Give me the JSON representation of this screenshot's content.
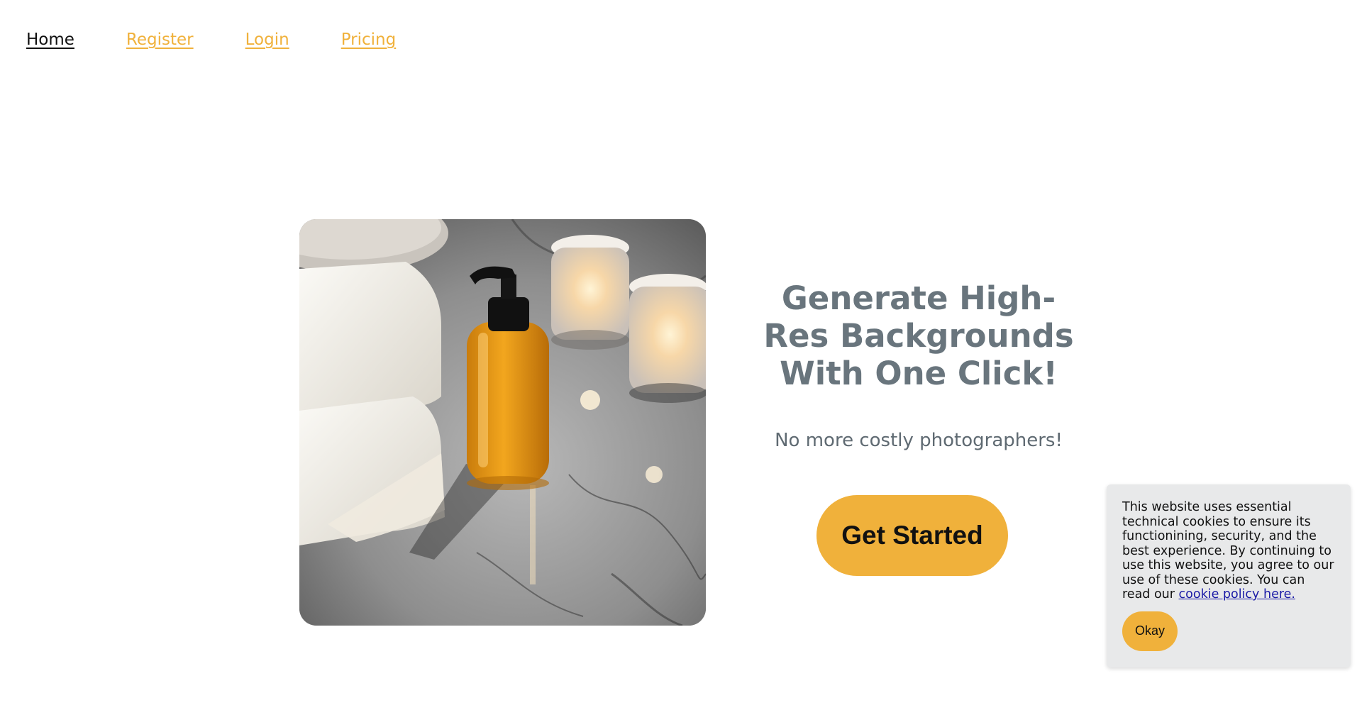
{
  "nav": {
    "items": [
      {
        "label": "Home"
      },
      {
        "label": "Register"
      },
      {
        "label": "Login"
      },
      {
        "label": "Pricing"
      }
    ]
  },
  "hero": {
    "headline": "Generate High-Res Backgrounds With One Click!",
    "subtext": "No more costly photographers!",
    "cta_label": "Get Started",
    "image_subject": "amber-soap-bottle-towels-candles-on-marble"
  },
  "cookie_banner": {
    "text": "This website uses essential technical cookies to ensure its functionining, security, and the best experience. By continuing to use this website, you agree to our use of these cookies. You can read our ",
    "link_label": "cookie policy here.",
    "button_label": "Okay"
  },
  "colors": {
    "accent": "#f0b13b",
    "headline": "#69757d",
    "cookie_bg": "#e8e9ea",
    "link": "#1a1aa6"
  }
}
